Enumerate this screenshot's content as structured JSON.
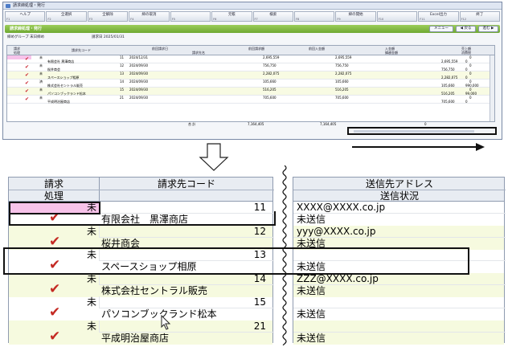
{
  "window": {
    "title": "請求締処理・発行",
    "fkeys": [
      {
        "label": "ヘルプ",
        "num": "F1"
      },
      {
        "label": "全選択",
        "num": "F2"
      },
      {
        "label": "全解除",
        "num": "F3"
      },
      {
        "label": "締の取消",
        "num": "F4"
      },
      {
        "label": "",
        "num": "F5"
      },
      {
        "label": "元帳",
        "num": "F6"
      },
      {
        "label": "検索",
        "num": "F7"
      },
      {
        "label": "",
        "num": "F8"
      },
      {
        "label": "締の開始",
        "num": "F9"
      },
      {
        "label": "",
        "num": "F10"
      },
      {
        "label": "Excel出力",
        "num": "F11"
      },
      {
        "label": "終了",
        "num": "F12"
      }
    ],
    "panel_title": "請求締処理・発行",
    "nav": {
      "menu": "メニュー",
      "prev": "◀ 戻る",
      "next": "進む ▶"
    },
    "filter_label": "締めグループ 末日締め",
    "filter_date": "請求日 2025/01/31",
    "columns": {
      "c1a": "請求",
      "c1b": "処理",
      "c2": "請求先コード",
      "c3": "前回請求日",
      "c4": "請求先名",
      "c5": "前回請求額",
      "c6": "前回入金額",
      "c7": "入金額",
      "c8": "繰越金額",
      "c9": "売上額",
      "c10": "消費税"
    },
    "rows": [
      {
        "status": "未",
        "code": "11",
        "date": "2024/12/31",
        "name": "有限会社 黒澤商店",
        "a1": "2,695,559",
        "a2": "2,695,559",
        "a3": "0",
        "a4": "2,695,559",
        "a5": "0"
      },
      {
        "status": "未",
        "code": "12",
        "date": "2024/09/30",
        "name": "桜井商会",
        "a1": "756,750",
        "a2": "756,750",
        "a3": "0",
        "a4": "756,750",
        "a5": "0"
      },
      {
        "status": "未",
        "code": "13",
        "date": "2024/09/30",
        "name": "スペースショップ相原",
        "a1": "2,282,075",
        "a2": "2,282,075",
        "a3": "0",
        "a4": "2,282,075",
        "a5": "0"
      },
      {
        "status": "済",
        "code": "14",
        "date": "2024/09/30",
        "name": "株式会社セントラル販売",
        "a1": "105,660",
        "a2": "105,660",
        "a3": "0",
        "a4": "105,660",
        "a5": "990,000"
      },
      {
        "status": "未",
        "code": "15",
        "date": "2024/09/30",
        "name": "パソコンブックランド松本",
        "a1": "516,205",
        "a2": "516,205",
        "a3": "0",
        "a4": "516,205",
        "a5": "99,000"
      },
      {
        "status": "未",
        "code": "21",
        "date": "2024/09/30",
        "name": "平成明治屋商店",
        "a1": "705,600",
        "a2": "705,600",
        "a3": "0",
        "a4": "705,600",
        "a5": "0"
      }
    ],
    "total_label": "合 計",
    "total_a1": "7,164,405",
    "total_a2": "7,164,405",
    "total_a3": "0"
  },
  "zoom_left": {
    "head_req": "請求",
    "head_proc": "処理",
    "head_code": "請求先コード",
    "rows": [
      {
        "status": "未",
        "code": "11",
        "name": "有限会社　黒澤商店",
        "checked": true
      },
      {
        "status": "未",
        "code": "12",
        "name": "桜井商会",
        "checked": true
      },
      {
        "status": "未",
        "code": "13",
        "name": "スペースショップ相原",
        "checked": true
      },
      {
        "status": "未",
        "code": "14",
        "name": "株式会社セントラル販売",
        "checked": true
      },
      {
        "status": "未",
        "code": "15",
        "name": "パソコンブックランド松本",
        "checked": true
      },
      {
        "status": "未",
        "code": "21",
        "name": "平成明治屋商店",
        "checked": true
      }
    ]
  },
  "zoom_right": {
    "head_addr": "送信先アドレス",
    "head_state": "送信状況",
    "rows": [
      {
        "addr": "XXXX@XXXX.co.jp",
        "state": "未送信"
      },
      {
        "addr": "yyy@XXXX.co.jp",
        "state": "未送信"
      },
      {
        "addr": "",
        "state": "未送信"
      },
      {
        "addr": "ZZZ@XXXX.co.jp",
        "state": "未送信"
      },
      {
        "addr": "",
        "state": "未送信"
      },
      {
        "addr": "",
        "state": "未送信"
      }
    ]
  },
  "colors": {
    "accent_green": "#7ab83d",
    "check_red": "#c42a23",
    "pink": "#f7c3ea",
    "row_alt": "#f6fadf"
  }
}
